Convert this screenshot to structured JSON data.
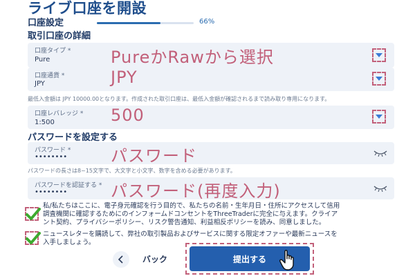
{
  "header": {
    "title": "ライブ口座を開設",
    "step_label": "口座設定",
    "progress_text": "66%",
    "progress_value": 0.66
  },
  "account_details": {
    "section_title": "取引口座の詳細",
    "account_type": {
      "label": "口座タイプ *",
      "value": "Pure",
      "overlay": "PureかRawから選択"
    },
    "currency": {
      "label": "口座通貨 *",
      "value": "JPY",
      "overlay": "JPY"
    },
    "min_deposit_note": "最低入金額は JPY 10000.00となります。作成された取引口座は、最低入金額が確認されるまで読み取り専用になります。",
    "leverage": {
      "label": "口座レバレッジ *",
      "value": "1:500",
      "overlay": "500"
    }
  },
  "password_section": {
    "section_title": "パスワードを設定する",
    "password": {
      "label": "パスワード *",
      "value": "••••••••",
      "overlay": "パスワード"
    },
    "password_note": "パスワードの長さは8~15文字で、大文字と小文字、数字を含める必要があります。",
    "confirm": {
      "label": "パスワードを認証する *",
      "value": "••••••••",
      "overlay": "パスワード(再度入力)"
    }
  },
  "consents": {
    "terms_line1": "私/私たちはここに、電子身元確認を行う目的で、私たちの名前・生年月日・住所にアクセスして信用",
    "terms_line2": "調査機関に確認するためにのインフォームドコンセントをThreeTraderに完全に与えます。クライア",
    "terms_line3": "ント契約、プライバシーポリシー、リスク警告通知、利益相反ポリシーを読み、同意しました。",
    "newsletter_line1": "ニュースレターを購読して、弊社の取引製品およびサービスに関する限定オファーや最新ニュースを",
    "newsletter_line2": "入手しましょう。"
  },
  "footer": {
    "back_label": "バック",
    "submit_label": "提出する"
  },
  "colors": {
    "accent": "#245fae",
    "annotation": "#c2607a",
    "check": "#3daa2f"
  },
  "icons": {
    "dropdown": "chevron-down-icon",
    "eye": "eye-closed-icon",
    "check": "check-icon",
    "back": "chevron-left-icon",
    "pointer": "hand-pointer-icon"
  }
}
